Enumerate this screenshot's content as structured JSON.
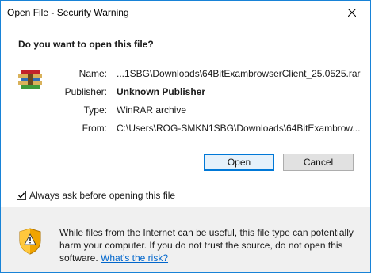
{
  "window": {
    "title": "Open File - Security Warning"
  },
  "dialog": {
    "question": "Do you want to open this file?",
    "fields": [
      {
        "label": "Name:",
        "value": "...1SBG\\Downloads\\64BitExambrowserClient_25.0525.rar"
      },
      {
        "label": "Publisher:",
        "value": "Unknown Publisher"
      },
      {
        "label": "Type:",
        "value": "WinRAR archive"
      },
      {
        "label": "From:",
        "value": "C:\\Users\\ROG-SMKN1SBG\\Downloads\\64BitExambrow..."
      }
    ],
    "buttons": {
      "open_label": "Open",
      "cancel_label": "Cancel"
    },
    "checkbox": {
      "label": "Always ask before opening this file",
      "checked": true
    }
  },
  "warning": {
    "text": "While files from the Internet can be useful, this file type can potentially harm your computer. If you do not trust the source, do not open this software.",
    "link": "What's the risk?"
  },
  "colors": {
    "window_border": "#1883d7",
    "link": "#0066cc",
    "default_button_border": "#0078d7"
  }
}
